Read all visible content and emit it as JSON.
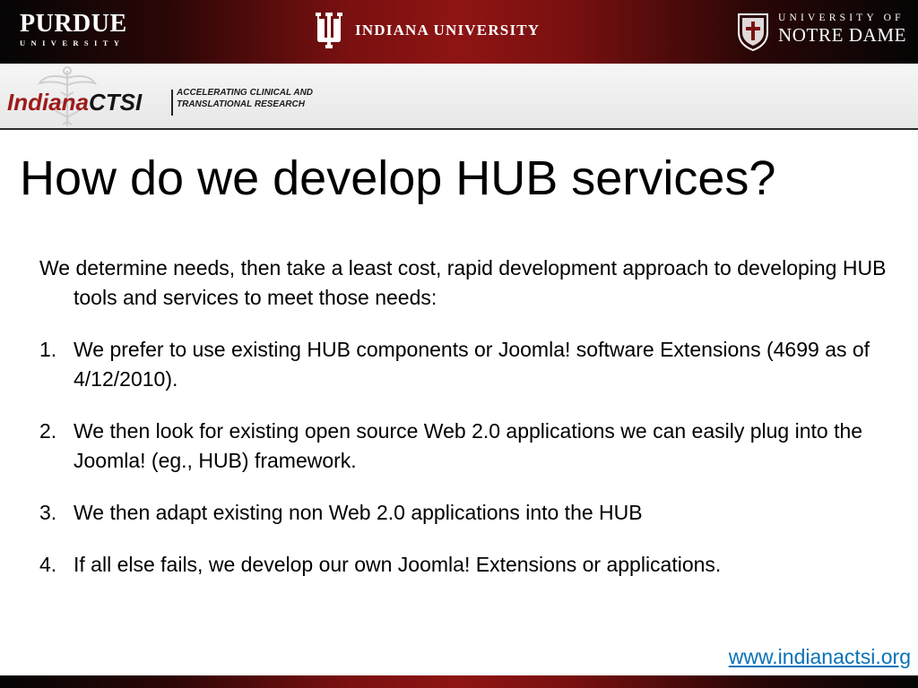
{
  "banner": {
    "purdue": {
      "name": "PURDUE",
      "sub": "UNIVERSITY"
    },
    "indiana": {
      "name": "INDIANA UNIVERSITY"
    },
    "notre_dame": {
      "line1": "UNIVERSITY OF",
      "line2": "NOTRE DAME"
    }
  },
  "logo": {
    "part1": "Indiana",
    "part2": "CTSI",
    "tagline_line1": "ACCELERATING CLINICAL AND",
    "tagline_line2": "TRANSLATIONAL RESEARCH"
  },
  "slide": {
    "title": "How do we develop HUB services?",
    "intro": "We determine needs, then take a least cost, rapid development approach to developing HUB tools and services to meet those needs:",
    "steps": [
      {
        "num": "1.",
        "text": "We prefer to use existing HUB components or Joomla! software Extensions (4699 as of 4/12/2010)."
      },
      {
        "num": "2.",
        "text": "We then look for existing open source Web 2.0 applications we can easily plug into the Joomla! (eg., HUB) framework."
      },
      {
        "num": "3.",
        "text": "We then adapt existing non Web 2.0 applications into the HUB"
      },
      {
        "num": "4.",
        "text": "If all else fails, we develop our own Joomla! Extensions or applications."
      }
    ],
    "footer_url": "www.indianactsi.org "
  },
  "colors": {
    "banner_red": "#8e1414",
    "ctsi_red": "#9e1a1a",
    "link_blue": "#0a72b8"
  }
}
